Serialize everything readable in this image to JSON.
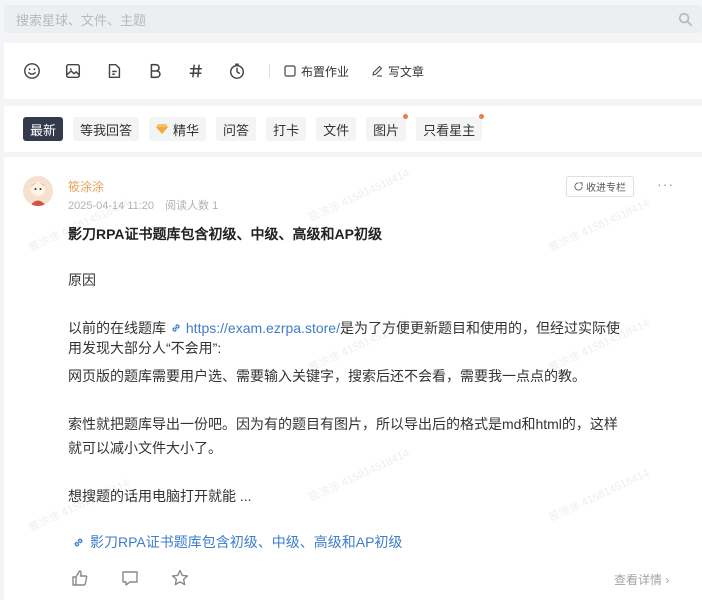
{
  "search": {
    "placeholder": "搜索星球、文件、主题"
  },
  "toolbar": {
    "icons": [
      "emoji-icon",
      "image-icon",
      "file-icon",
      "bold-icon",
      "hashtag-icon",
      "clock-icon"
    ],
    "assign_homework": "布置作业",
    "write_article": "写文章"
  },
  "tabs": [
    {
      "label": "最新",
      "active": true
    },
    {
      "label": "等我回答"
    },
    {
      "label": "精华",
      "icon": "gem-icon"
    },
    {
      "label": "问答"
    },
    {
      "label": "打卡"
    },
    {
      "label": "文件"
    },
    {
      "label": "图片",
      "dot": true
    },
    {
      "label": "只看星主",
      "dot": true
    }
  ],
  "post": {
    "author": "筱涂涂",
    "date": "2025-04-14 11:20",
    "read_count": "阅读人数 1",
    "collect_label": "收进专栏",
    "more": "···",
    "title": "影刀RPA证书题库包含初级、中级、高级和AP初级",
    "reason": "原因",
    "p_before_link": "以前的在线题库 ",
    "link_url": "https://exam.ezrpa.store/",
    "p_after_link": "是为了方便更新题目和使用的，但经过实际使",
    "p_line2": "用发现大部分人“不会用”:",
    "p_line3": "网页版的题库需要用户选、需要输入关键字，搜索后还不会看，需要我一点点的教。",
    "p_line4": "索性就把题库导出一份吧。因为有的题目有图片，所以导出后的格式是md和html的，这样",
    "p_line5": "就可以减小文件大小了。",
    "p_line6": "想搜题的话用电脑打开就能 ...",
    "attachment_link": "影刀RPA证书题库包含初级、中级、高级和AP初级",
    "view_detail": "查看详情 ›",
    "watermark": "筱涂涂 415814518414"
  },
  "colors": {
    "accent_link": "#3d7dcb",
    "author": "#e8a05a",
    "active_tab": "#323a4c",
    "dot": "#f07a4a"
  }
}
